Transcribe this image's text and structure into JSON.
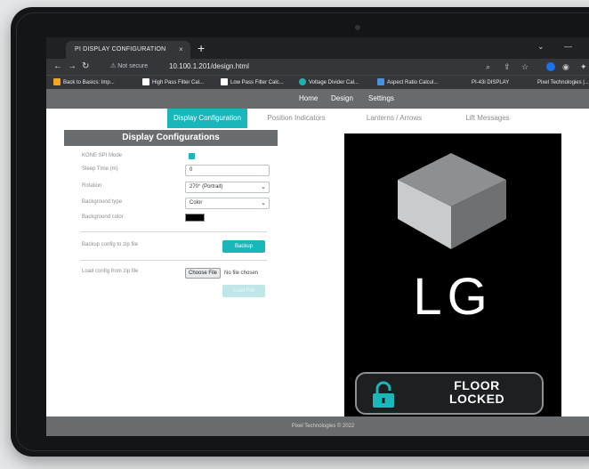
{
  "browser": {
    "tab_title": "PI DISPLAY CONFIGURATION",
    "tab_close": "×",
    "new_tab": "+",
    "url_security": "Not secure",
    "url": "10.100.1.201/design.html",
    "bookmarks": [
      {
        "label": "Back to Basics: Imp...",
        "color": "#f5a623"
      },
      {
        "label": "High Pass Filter Cal...",
        "color": "#ffffff"
      },
      {
        "label": "Low Pass Filter Calc...",
        "color": "#ffffff"
      },
      {
        "label": "Voltage Divider Cal...",
        "color": "#20b2aa"
      },
      {
        "label": "Aspect Ratio Calcul...",
        "color": "#4a90e2"
      },
      {
        "label": "PI-43i DISPLAY",
        "color": ""
      },
      {
        "label": "Pixel Technologies |...",
        "color": ""
      }
    ]
  },
  "app": {
    "menu": [
      "Home",
      "Design",
      "Settings"
    ],
    "subtabs": [
      "Display Configuration",
      "Position Indicators",
      "Lanterns / Arrows",
      "Lift Messages"
    ],
    "active_subtab": "Display Configuration",
    "accent_color": "#19b7b9"
  },
  "config": {
    "title": "Display Configurations",
    "kone_label": "KONE SPI Mode",
    "kone_checked": true,
    "sleep_label": "Sleep Time (m)",
    "sleep_value": "0",
    "rotation_label": "Rotation",
    "rotation_value": "270° (Portrait)",
    "bgtype_label": "Background type",
    "bgtype_value": "Color",
    "bgcolor_label": "Background color",
    "bgcolor_value": "#000000",
    "backup_label": "Backup config to zip file",
    "backup_button": "Backup",
    "load_label": "Load config from zip file",
    "choose_file": "Choose File",
    "no_file": "No file chosen",
    "load_button": "Load File"
  },
  "preview": {
    "floor_text": "LG",
    "banner_line1": "FLOOR",
    "banner_line2": "LOCKED"
  },
  "footer": {
    "text": "Pixel Technologies © 2022"
  }
}
